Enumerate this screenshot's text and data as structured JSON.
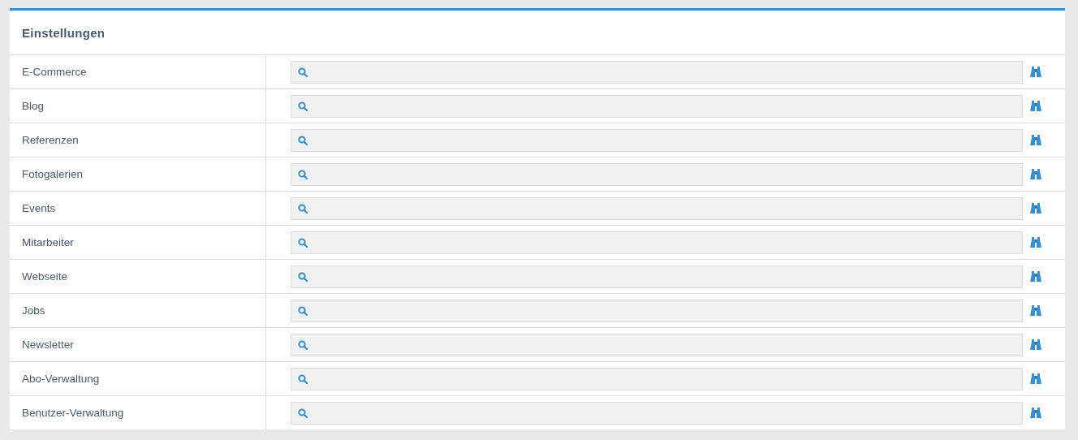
{
  "panel": {
    "title": "Einstellungen"
  },
  "rows": [
    {
      "label": "E-Commerce"
    },
    {
      "label": "Blog"
    },
    {
      "label": "Referenzen"
    },
    {
      "label": "Fotogalerien"
    },
    {
      "label": "Events"
    },
    {
      "label": "Mitarbeiter"
    },
    {
      "label": "Webseite"
    },
    {
      "label": "Jobs"
    },
    {
      "label": "Newsletter"
    },
    {
      "label": "Abo-Verwaltung"
    },
    {
      "label": "Benutzer-Verwaltung"
    }
  ]
}
